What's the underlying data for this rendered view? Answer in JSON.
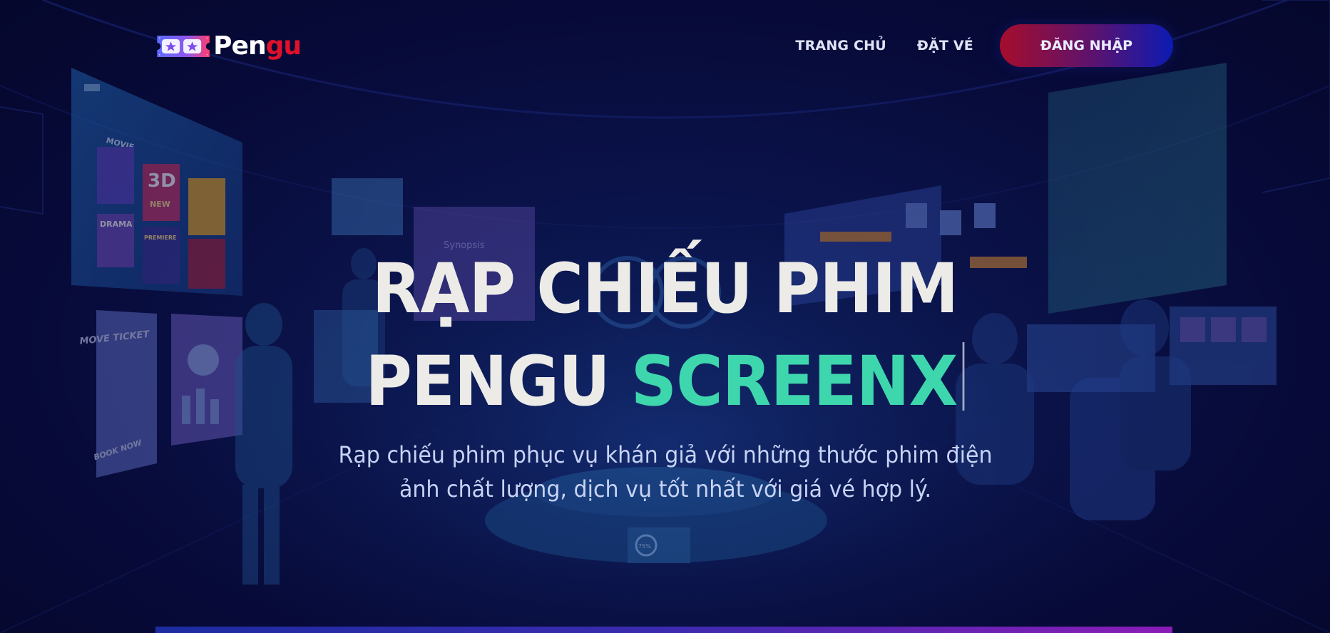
{
  "brand": {
    "logo_part1": "Pen",
    "logo_part2": "gu",
    "colors": {
      "logo_white": "#ffffff",
      "logo_red": "#e0112b"
    }
  },
  "nav": {
    "home_label": "TRANG CHỦ",
    "booking_label": "ĐẶT VÉ",
    "login_label": "ĐĂNG NHẬP"
  },
  "hero": {
    "title_line1": "RẠP CHIẾU PHIM",
    "title_line2_plain": "PENGU ",
    "title_line2_accent": "SCREENX",
    "subtitle_line1": "Rạp chiếu phim phục vụ khán giả với những thước phim điện",
    "subtitle_line2": "ảnh chất lượng, dịch vụ tốt nhất với giá vé hợp lý."
  },
  "background_illustration": {
    "screen_left_tag": "MOVIE",
    "screen_left_3d": "3D",
    "screen_left_3d_sub": "NEW",
    "screen_left_drama": "DRAMA",
    "screen_left_premiere": "PREMIERE",
    "poster_top": "MOVE TICKET",
    "poster_bottom": "BOOK NOW",
    "center_panel": "Synopsis",
    "progress_label": "75%"
  },
  "theme": {
    "background": "#07093a",
    "accent_green": "#3ed7ad",
    "title_white": "#ecebe7",
    "subtitle_blue": "#c7d3f5",
    "button_gradient_start": "#a50d2c",
    "button_gradient_end": "#0b1bb3"
  }
}
